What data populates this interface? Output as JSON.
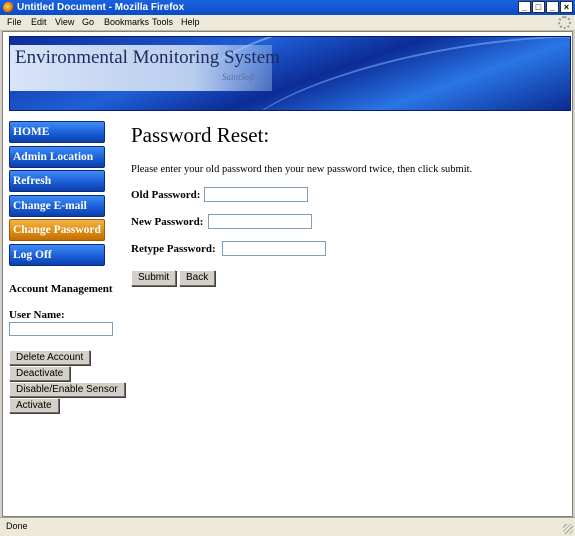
{
  "window": {
    "title": "Untitled Document - Mozilla Firefox"
  },
  "menu": [
    {
      "label": "File"
    },
    {
      "label": "Edit"
    },
    {
      "label": "View"
    },
    {
      "label": "Go"
    },
    {
      "label": "Bookmarks"
    },
    {
      "label": "Tools"
    },
    {
      "label": "Help"
    }
  ],
  "banner": {
    "title": "Environmental Monitoring System",
    "brand": "SaintSoft"
  },
  "nav": {
    "items": [
      {
        "label": "HOME"
      },
      {
        "label": "Admin Location"
      },
      {
        "label": "Refresh"
      },
      {
        "label": "Change E-mail"
      },
      {
        "label": "Change Password",
        "active": true
      },
      {
        "label": "Log Off"
      }
    ],
    "active_color": "#df8c12",
    "color": "#1b5ed8"
  },
  "account": {
    "heading": "Account Management",
    "user_label": "User Name:",
    "user_value": "",
    "buttons": {
      "delete": "Delete Account",
      "deactivate": "Deactivate",
      "sensor": "Disable/Enable Sensor",
      "activate": "Activate"
    }
  },
  "form": {
    "title": "Password Reset:",
    "instructions": "Please enter your old password then your new password twice, then click submit.",
    "old_label": "Old Password:",
    "new_label": "New Password:",
    "retype_label": "Retype Password:",
    "submit": "Submit",
    "back": "Back"
  },
  "status": {
    "text": "Done"
  }
}
